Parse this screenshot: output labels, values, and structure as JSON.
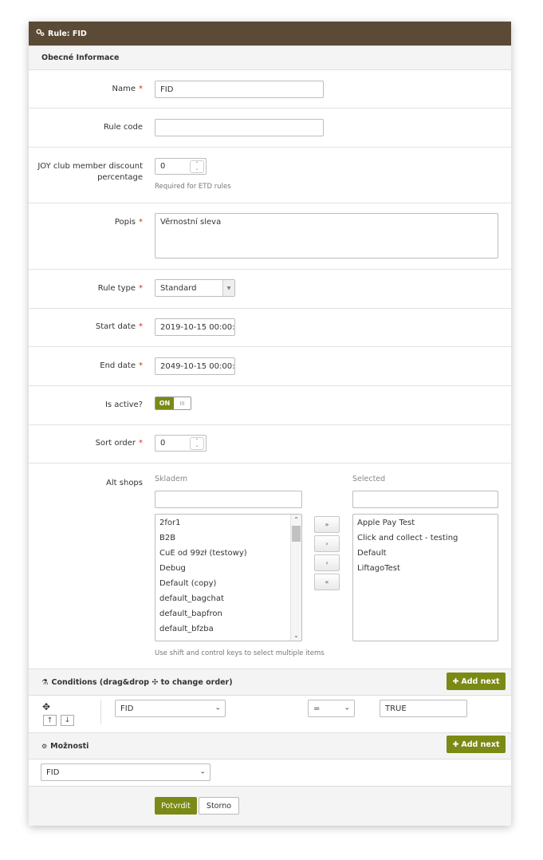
{
  "header": {
    "title": "Rule: FID",
    "icon": "gears-icon"
  },
  "section_general": {
    "title": "Obecné Informace"
  },
  "fields": {
    "name": {
      "label": "Name",
      "value": "FID",
      "required": "*"
    },
    "rule_code": {
      "label": "Rule code",
      "value": ""
    },
    "joy_discount": {
      "label_line1": "JOY club member discount",
      "label_line2": "percentage",
      "value": "0",
      "help": "Required for ETD rules"
    },
    "popis": {
      "label": "Popis",
      "value": "Věrnostní sleva",
      "required": "*"
    },
    "rule_type": {
      "label": "Rule type",
      "value": "Standard",
      "required": "*"
    },
    "start_date": {
      "label": "Start date",
      "value": "2019-10-15 00:00:00",
      "required": "*"
    },
    "end_date": {
      "label": "End date",
      "value": "2049-10-15 00:00:00",
      "required": "*"
    },
    "is_active": {
      "label": "Is active?",
      "on_label": "ON",
      "off_label": "III"
    },
    "sort_order": {
      "label": "Sort order",
      "value": "0",
      "required": "*"
    },
    "alt_shops": {
      "label": "Alt shops",
      "available_title": "Skladem",
      "selected_title": "Selected",
      "available_filter": "",
      "selected_filter": "",
      "available": [
        "2for1",
        "B2B",
        "CuE od 99zł (testowy)",
        "Debug",
        "Default (copy)",
        "default_bagchat",
        "default_bapfron",
        "default_bfzba"
      ],
      "selected": [
        "Apple Pay Test",
        "Click and collect - testing",
        "Default",
        "LiftagoTest"
      ],
      "help": "Use shift and control keys to select multiple items",
      "move_all_right": "»",
      "move_right": "›",
      "move_left": "‹",
      "move_all_left": "«"
    }
  },
  "conditions": {
    "title": "Conditions (drag&drop ✣ to change order)",
    "add_label": "Add next",
    "row": {
      "field": "FID",
      "operator": "=",
      "value": "TRUE"
    }
  },
  "options": {
    "title": "Možnosti",
    "add_label": "Add next",
    "value": "FID"
  },
  "footer": {
    "submit": "Potvrdit",
    "cancel": "Storno"
  },
  "colors": {
    "header_bg": "#5b4a36",
    "accent": "#7a8a14",
    "required": "#c9302c"
  }
}
